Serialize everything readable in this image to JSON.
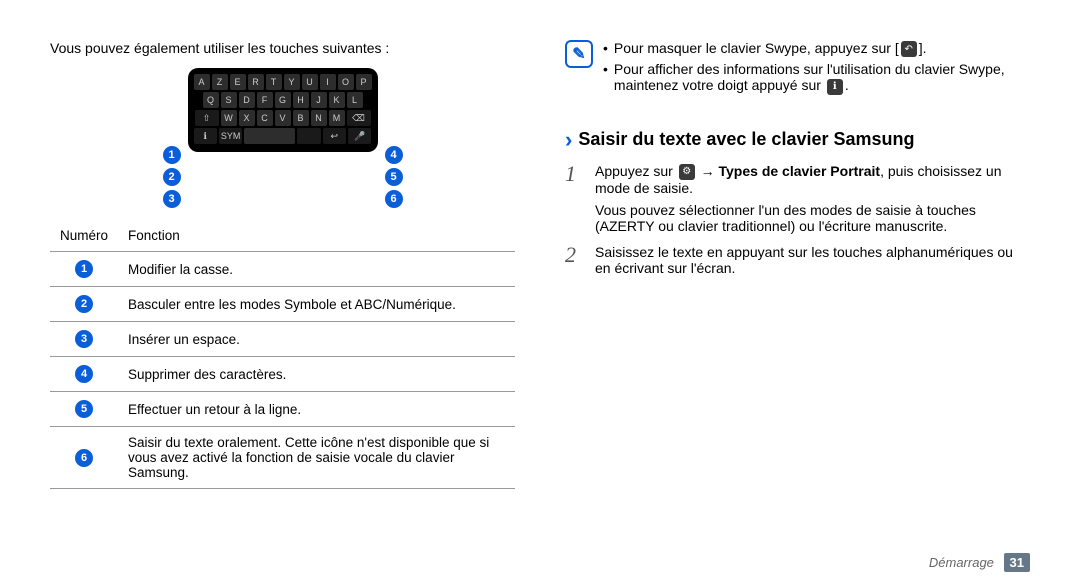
{
  "left": {
    "intro": "Vous pouvez également utiliser les touches suivantes :",
    "keyboard_rows": [
      [
        "A",
        "Z",
        "E",
        "R",
        "T",
        "Y",
        "U",
        "I",
        "O",
        "P"
      ],
      [
        "Q",
        "S",
        "D",
        "F",
        "G",
        "H",
        "J",
        "K",
        "L"
      ],
      [
        "⇧",
        "W",
        "X",
        "C",
        "V",
        "B",
        "N",
        "M",
        "⌫"
      ],
      [
        "ℹ",
        "SYM",
        "",
        "",
        "↩",
        "🎤"
      ]
    ],
    "callout_left": [
      "1",
      "2",
      "3"
    ],
    "callout_right": [
      "4",
      "5",
      "6"
    ],
    "table": {
      "headers": [
        "Numéro",
        "Fonction"
      ],
      "rows": [
        {
          "n": "1",
          "desc": "Modifier la casse."
        },
        {
          "n": "2",
          "desc": "Basculer entre les modes Symbole et ABC/Numérique."
        },
        {
          "n": "3",
          "desc": "Insérer un espace."
        },
        {
          "n": "4",
          "desc": "Supprimer des caractères."
        },
        {
          "n": "5",
          "desc": "Effectuer un retour à la ligne."
        },
        {
          "n": "6",
          "desc": "Saisir du texte oralement. Cette icône n'est disponible que si vous avez activé la fonction de saisie vocale du clavier Samsung."
        }
      ]
    }
  },
  "right": {
    "notes": {
      "icon_glyph": "✎",
      "items": [
        {
          "pre": "Pour masquer le clavier Swype, appuyez sur [",
          "icon": "↶",
          "post": "]."
        },
        {
          "pre": "Pour afficher des informations sur l'utilisation du clavier Swype, maintenez votre doigt appuyé sur ",
          "icon": "ℹ",
          "post": "."
        }
      ]
    },
    "heading": "Saisir du texte avec le clavier Samsung",
    "steps": [
      {
        "num": "1",
        "pre": "Appuyez sur ",
        "icon": "⚙",
        "mid": " → ",
        "bold": "Types de clavier Portrait",
        "post": ", puis choisissez un mode de saisie.",
        "sub": "Vous pouvez sélectionner l'un des modes de saisie à touches (AZERTY ou clavier traditionnel) ou l'écriture manuscrite."
      },
      {
        "num": "2",
        "pre": "Saisissez le texte en appuyant sur les touches alphanumériques ou en écrivant sur l'écran.",
        "icon": "",
        "mid": "",
        "bold": "",
        "post": "",
        "sub": ""
      }
    ]
  },
  "footer": {
    "label": "Démarrage",
    "page": "31"
  }
}
